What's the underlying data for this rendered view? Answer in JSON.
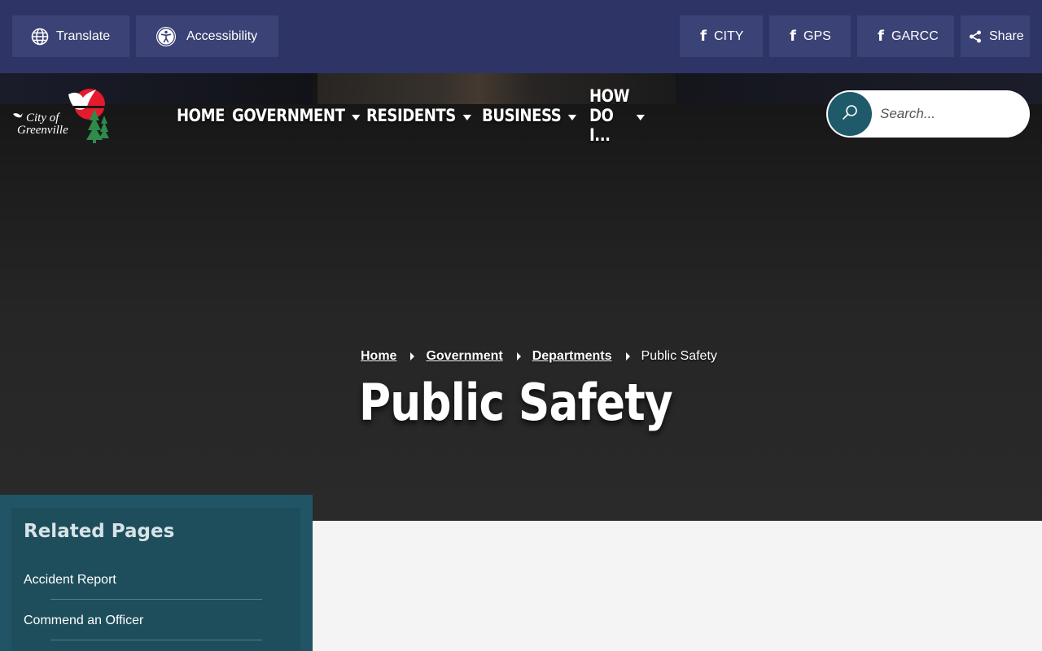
{
  "utility": {
    "translate_label": "Translate",
    "accessibility_label": "Accessibility",
    "facebook_links": [
      {
        "label": "CITY"
      },
      {
        "label": "GPS"
      },
      {
        "label": "GARCC"
      }
    ],
    "share_label": "Share"
  },
  "logo": {
    "line1": "City of",
    "line2": "Greenville"
  },
  "nav": {
    "items": [
      {
        "label": "HOME"
      },
      {
        "label": "GOVERNMENT"
      },
      {
        "label": "RESIDENTS"
      },
      {
        "label": "BUSINESS"
      },
      {
        "label": "HOW DO I..."
      }
    ]
  },
  "search": {
    "placeholder": "Search..."
  },
  "breadcrumb": {
    "items": [
      {
        "label": "Home"
      },
      {
        "label": "Government"
      },
      {
        "label": "Departments"
      }
    ],
    "current": "Public Safety"
  },
  "page": {
    "title": "Public Safety"
  },
  "sidebar": {
    "title": "Related Pages",
    "links": [
      {
        "label": "Accident Report"
      },
      {
        "label": "Commend an Officer"
      }
    ]
  },
  "colors": {
    "utility_bar": "#2e3466",
    "utility_button": "#3b4275",
    "accent_teal": "#1f5a6b",
    "sidebar": "#215565"
  }
}
